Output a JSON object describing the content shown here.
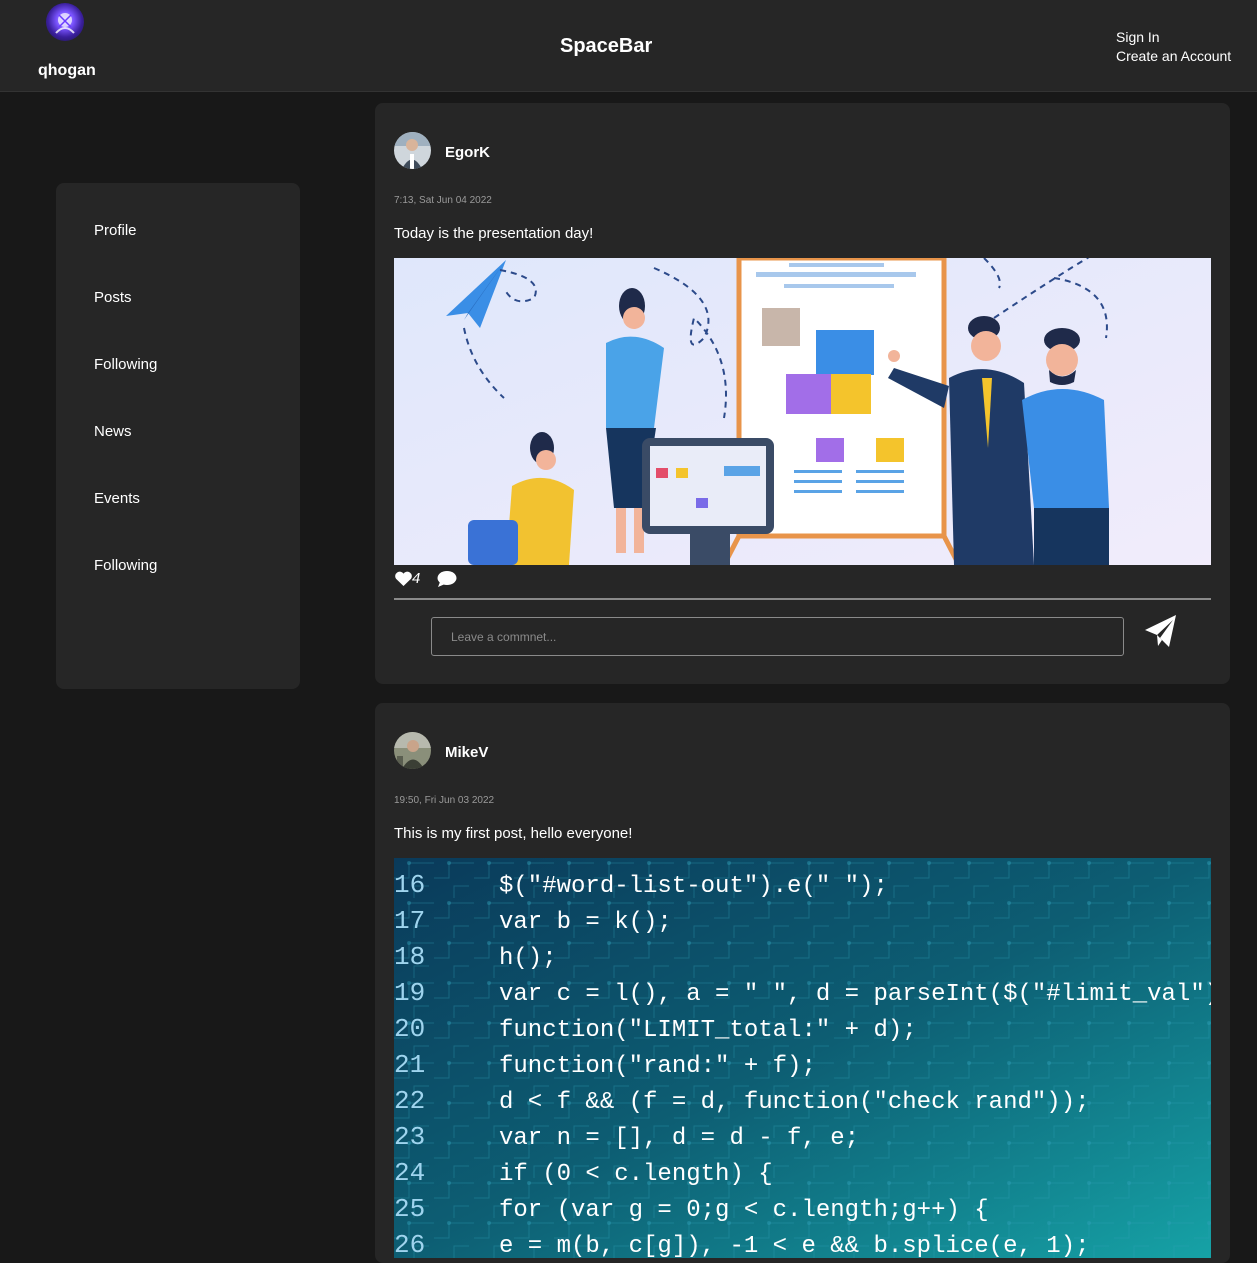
{
  "header": {
    "username": "qhogan",
    "app_title": "SpaceBar",
    "sign_in": "Sign In",
    "create_account": "Create an Account"
  },
  "sidebar": {
    "items": [
      {
        "label": "Profile"
      },
      {
        "label": "Posts"
      },
      {
        "label": "Following"
      },
      {
        "label": "News"
      },
      {
        "label": "Events"
      },
      {
        "label": "Following"
      }
    ]
  },
  "posts": [
    {
      "author": "EgorK",
      "time": "7:13, Sat Jun 04 2022",
      "text": "Today is the presentation day!",
      "likes": "4",
      "comment_placeholder": "Leave a commnet..."
    },
    {
      "author": "MikeV",
      "time": "19:50, Fri Jun 03 2022",
      "text": "This is my first post, hello everyone!",
      "code_lines": [
        {
          "num": "16",
          "code": "$(\"#word-list-out\").e(\" \");"
        },
        {
          "num": "17",
          "code": "var b = k();"
        },
        {
          "num": "18",
          "code": "h();"
        },
        {
          "num": "19",
          "code": "var c = l(), a = \" \", d = parseInt($(\"#limit_val\").a());"
        },
        {
          "num": "20",
          "code": "function(\"LIMIT_total:\" + d);"
        },
        {
          "num": "21",
          "code": "function(\"rand:\" + f);"
        },
        {
          "num": "22",
          "code": "d < f && (f = d, function(\"check rand\"));"
        },
        {
          "num": "23",
          "code": "var n = [], d = d - f, e;"
        },
        {
          "num": "24",
          "code": "if (0 < c.length) {"
        },
        {
          "num": "25",
          "code": "  for (var g = 0;g < c.length;g++) {"
        },
        {
          "num": "26",
          "code": "    e = m(b, c[g]), -1 < e && b.splice(e, 1);"
        }
      ]
    }
  ],
  "colors": {
    "background": "#181818",
    "panel": "#262626",
    "text": "#ffffff",
    "muted": "#9a9a9a",
    "code_bg": "#0d5e73",
    "code_text": "#ffffff"
  },
  "icons": {
    "like": "heart-icon",
    "comment": "speech-bubble-icon",
    "send": "paper-plane-icon"
  }
}
